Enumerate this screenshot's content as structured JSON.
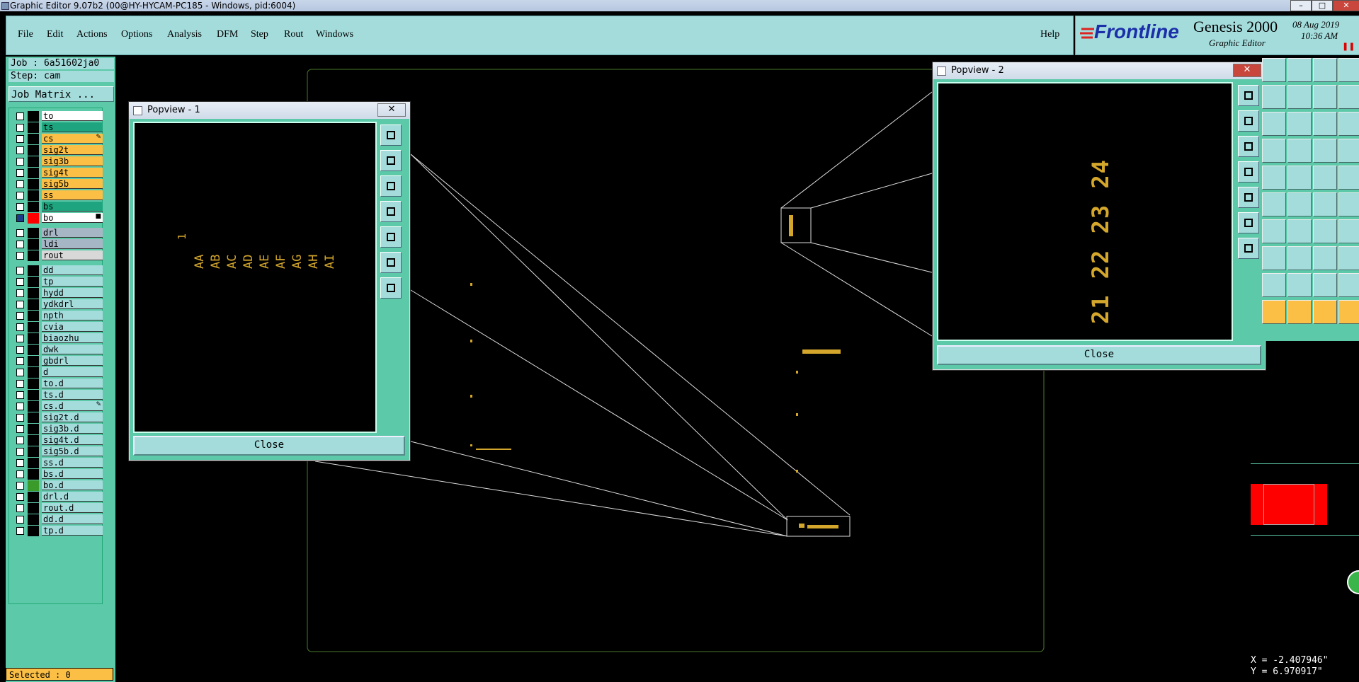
{
  "window": {
    "title": "Graphic Editor 9.07b2 (00@HY-HYCAM-PC185 - Windows, pid:6004)"
  },
  "menu": {
    "items": [
      "File",
      "Edit",
      "Actions",
      "Options",
      "Analysis",
      "DFM",
      "Step",
      "Rout",
      "Windows"
    ],
    "help": "Help"
  },
  "brand": {
    "logo": "Frontline",
    "product": "Genesis 2000",
    "subtitle": "Graphic Editor",
    "date": "08 Aug 2019",
    "time": "10:36 AM"
  },
  "job": {
    "job_label": "Job : 6a51602ja0",
    "step_label": "Step: cam",
    "matrix_button": "Job Matrix ..."
  },
  "layers_group1": [
    {
      "name": "to",
      "color": "#ffffff"
    },
    {
      "name": "ts",
      "color": "#1ea47e"
    },
    {
      "name": "cs",
      "color": "#fbbf45",
      "mark": "✎"
    },
    {
      "name": "sig2t",
      "color": "#fbbf45"
    },
    {
      "name": "sig3b",
      "color": "#fbbf45"
    },
    {
      "name": "sig4t",
      "color": "#fbbf45"
    },
    {
      "name": "sig5b",
      "color": "#fbbf45"
    },
    {
      "name": "ss",
      "color": "#fbbf45"
    },
    {
      "name": "bs",
      "color": "#1ea47e"
    },
    {
      "name": "bo",
      "color": "#ffffff",
      "active": true,
      "mark": "■"
    }
  ],
  "layers_group2": [
    {
      "name": "drl",
      "color": "#a6b6c4"
    },
    {
      "name": "ldi",
      "color": "#a6b6c4"
    },
    {
      "name": "rout",
      "color": "#d8d8d8"
    }
  ],
  "layers_group3": [
    {
      "name": "dd"
    },
    {
      "name": "tp"
    },
    {
      "name": "hydd"
    },
    {
      "name": "ydkdrl"
    },
    {
      "name": "npth"
    },
    {
      "name": "cvia"
    },
    {
      "name": "biaozhu"
    },
    {
      "name": "dwk"
    },
    {
      "name": "gbdrl"
    },
    {
      "name": "d"
    },
    {
      "name": "to.d"
    },
    {
      "name": "ts.d"
    },
    {
      "name": "cs.d",
      "mark": "✎"
    },
    {
      "name": "sig2t.d"
    },
    {
      "name": "sig3b.d"
    },
    {
      "name": "sig4t.d"
    },
    {
      "name": "sig5b.d"
    },
    {
      "name": "ss.d"
    },
    {
      "name": "bs.d"
    },
    {
      "name": "bo.d",
      "swatch": "#3a9a2a"
    },
    {
      "name": "drl.d"
    },
    {
      "name": "rout.d"
    },
    {
      "name": "dd.d"
    },
    {
      "name": "tp.d"
    }
  ],
  "status": {
    "selected": "Selected : 0"
  },
  "popview1": {
    "title": "Popview - 1",
    "close_label": "Close",
    "number": "1",
    "letters": [
      "AA",
      "AB",
      "AC",
      "AD",
      "AE",
      "AF",
      "AG",
      "AH",
      "AI"
    ]
  },
  "popview2": {
    "title": "Popview - 2",
    "close_label": "Close",
    "numbers": "21 22 23 24"
  },
  "coords": {
    "x": "X = -2.407946\"",
    "y": "Y = 6.970917\""
  },
  "colors": {
    "panel": "#5cc9a8",
    "menu": "#a4dcdc",
    "layer_yellow": "#fbbf45",
    "layer_green": "#1ea47e",
    "feature": "#d4a72c"
  }
}
